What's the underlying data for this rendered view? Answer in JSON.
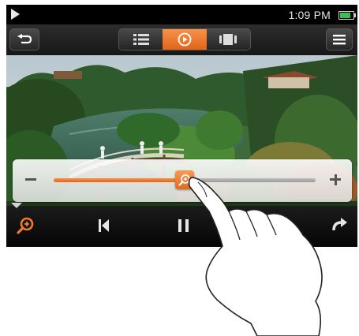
{
  "status_bar": {
    "play_indicator_icon": "play-icon",
    "time": "1:09 PM",
    "battery_icon": "battery-icon",
    "battery_level": 0.8,
    "battery_color": "#38c24d"
  },
  "toolbar": {
    "back_icon": "back-arrow-icon",
    "menu_icon": "menu-icon",
    "view_modes": [
      {
        "icon": "list-view-icon",
        "active": false
      },
      {
        "icon": "play-view-icon",
        "active": true
      },
      {
        "icon": "filmstrip-view-icon",
        "active": false
      }
    ]
  },
  "zoom_slider": {
    "minus_icon": "minus-icon",
    "plus_icon": "plus-icon",
    "thumb_icon": "zoom-icon",
    "value": 0.5,
    "accent_color": "#f07a2c"
  },
  "controls": {
    "zoom_icon": "zoom-icon",
    "previous_icon": "previous-track-icon",
    "pause_icon": "pause-icon",
    "rotate_icon": "rotate-icon"
  }
}
